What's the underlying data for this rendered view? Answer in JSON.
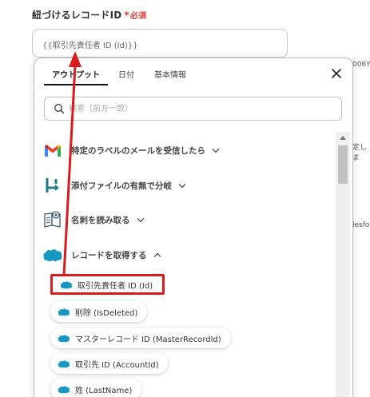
{
  "field": {
    "label": "紐づけるレコードID",
    "required_star": "*",
    "required_text": "必須",
    "value": "{{取引先責任者 ID (Id)}}"
  },
  "background_fragments": [
    "006Y",
    "定しま",
    "lesfor"
  ],
  "tabs": [
    {
      "label": "アウトプット",
      "active": true
    },
    {
      "label": "日付",
      "active": false
    },
    {
      "label": "基本情報",
      "active": false
    }
  ],
  "search": {
    "placeholder": "検索（前方一致）"
  },
  "sections": [
    {
      "label": "特定のラベルのメールを受信したら",
      "icon": "gmail-icon",
      "expanded": false
    },
    {
      "label": "添付ファイルの有無で分岐",
      "icon": "branch-icon",
      "expanded": false
    },
    {
      "label": "名刺を読み取る",
      "icon": "business-card-icon",
      "expanded": false
    },
    {
      "label": "レコードを取得する",
      "icon": "salesforce-icon",
      "expanded": true
    }
  ],
  "fields": [
    {
      "label": "取引先責任者 ID (Id)",
      "highlighted": true
    },
    {
      "label": "削除 (IsDeleted)",
      "highlighted": false
    },
    {
      "label": "マスターレコード ID (MasterRecordId)",
      "highlighted": false
    },
    {
      "label": "取引先 ID (AccountId)",
      "highlighted": false
    },
    {
      "label": "姓 (LastName)",
      "highlighted": false
    }
  ],
  "colors": {
    "accent_red": "#d81b1b",
    "required_red": "#e53935",
    "salesforce_blue": "#1798c1"
  }
}
